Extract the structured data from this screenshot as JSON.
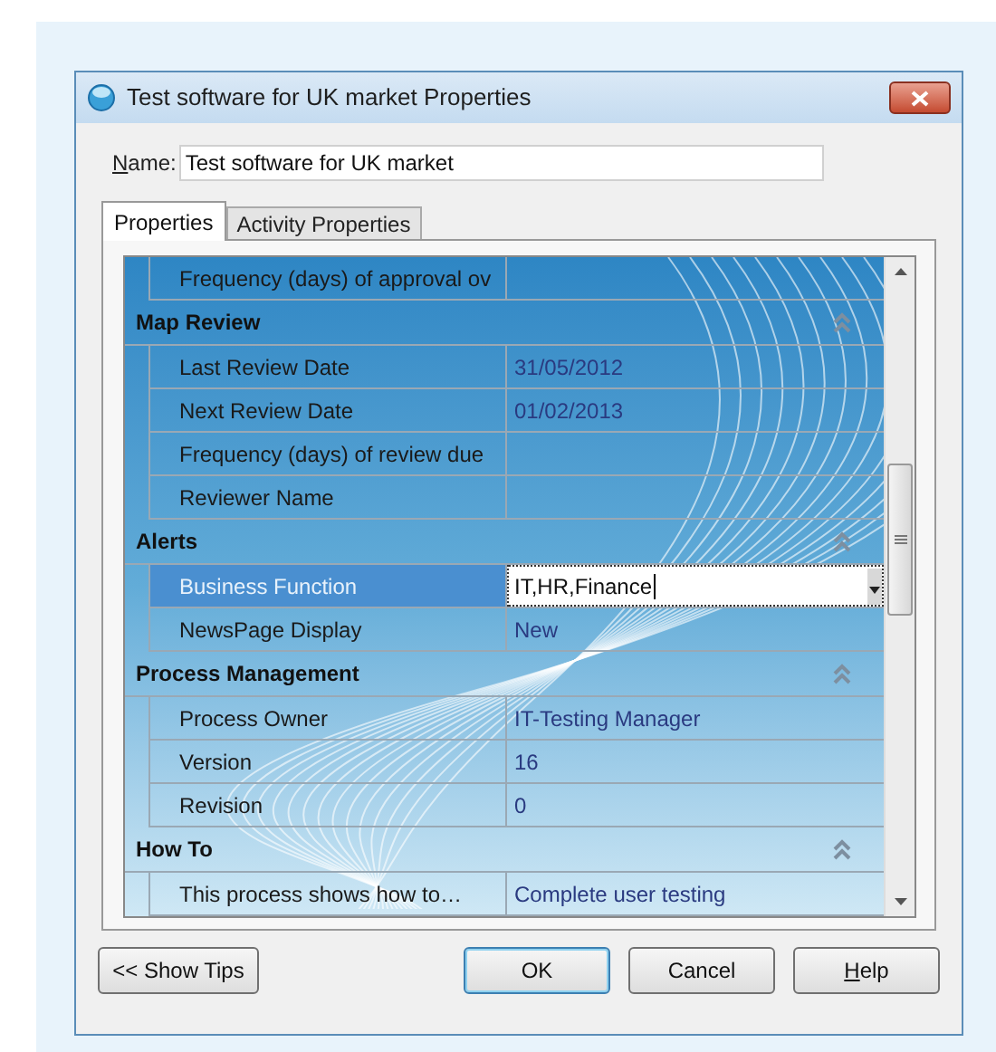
{
  "window": {
    "title": "Test software for UK market Properties"
  },
  "name_field": {
    "label": "Name:",
    "access_key_underlined": true,
    "value": "Test software for UK market"
  },
  "tabs": [
    {
      "label": "Properties",
      "selected": true
    },
    {
      "label": "Activity Properties",
      "selected": false
    }
  ],
  "grid": [
    {
      "kind": "property",
      "label": "Frequency (days) of approval ov",
      "selected": false
    },
    {
      "kind": "section",
      "title": "Map Review",
      "expanded": true
    },
    {
      "kind": "property",
      "label": "Last Review Date",
      "value": "31/05/2012",
      "selected": false
    },
    {
      "kind": "property",
      "label": "Next Review Date",
      "value": "01/02/2013",
      "selected": false
    },
    {
      "kind": "property",
      "label": "Frequency (days) of review due",
      "selected": false
    },
    {
      "kind": "property",
      "label": "Reviewer Name",
      "selected": false
    },
    {
      "kind": "section",
      "title": "Alerts",
      "expanded": true
    },
    {
      "kind": "property",
      "label": "Business Function",
      "value": "IT,HR,Finance",
      "selected": true
    },
    {
      "kind": "property",
      "label": "NewsPage Display",
      "value": "New",
      "selected": false
    },
    {
      "kind": "section",
      "title": "Process Management",
      "expanded": true
    },
    {
      "kind": "property",
      "label": "Process Owner",
      "value": "IT-Testing Manager",
      "selected": false
    },
    {
      "kind": "property",
      "label": "Version",
      "value": "16",
      "selected": false
    },
    {
      "kind": "property",
      "label": "Revision",
      "value": "0",
      "selected": false
    },
    {
      "kind": "section",
      "title": "How To",
      "expanded": true
    },
    {
      "kind": "property",
      "label": "This process shows how to…",
      "value": "Complete user testing",
      "selected": false
    }
  ],
  "buttons": [
    {
      "label": "<< Show Tips",
      "kind": "left"
    },
    {
      "label": "OK",
      "kind": "default"
    },
    {
      "label": "Cancel",
      "kind": "normal"
    },
    {
      "label": "Help",
      "kind": "normal",
      "access_key_underlined": true
    }
  ]
}
